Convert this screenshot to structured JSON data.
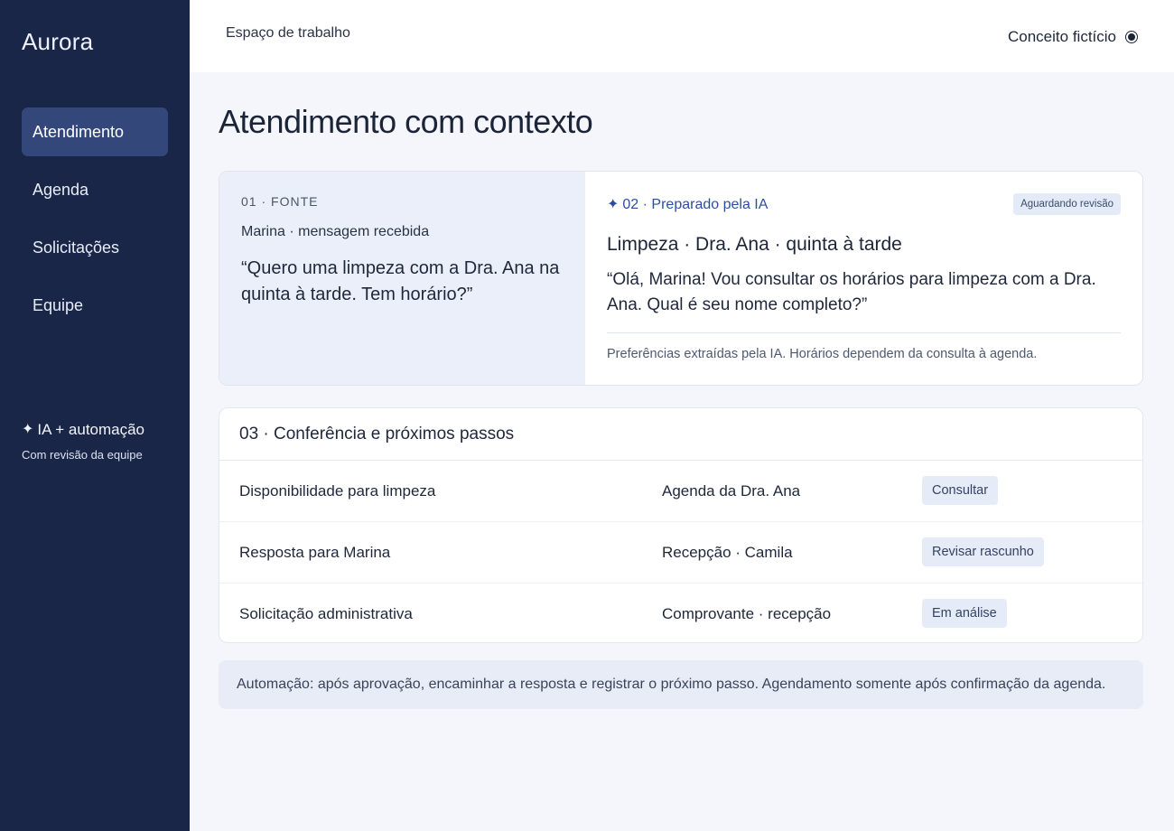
{
  "app": {
    "name": "Aurora"
  },
  "sidebar": {
    "items": [
      {
        "label": "Atendimento",
        "active": true
      },
      {
        "label": "Agenda",
        "active": false
      },
      {
        "label": "Solicitações",
        "active": false
      },
      {
        "label": "Equipe",
        "active": false
      }
    ],
    "ai_title": "IA + automação",
    "ai_subtitle": "Com revisão da equipe",
    "ai_icon": "sparkle-icon"
  },
  "topbar": {
    "workspace": "Espaço de trabalho",
    "concept_label": "Conceito fictício",
    "concept_icon": "radio-icon"
  },
  "main": {
    "title": "Atendimento com contexto",
    "source": {
      "label": "01 · FONTE",
      "from": "Marina · mensagem recebida",
      "message": "“Quero uma limpeza com a Dra. Ana na quinta à tarde. Tem horário?”"
    },
    "prepared": {
      "label": "02 · Preparado pela IA",
      "status_badge": "Aguardando revisão",
      "title": "Limpeza · Dra. Ana · quinta à tarde",
      "reply": "“Olá, Marina! Vou consultar os horários para limpeza com a Dra. Ana. Qual é seu nome completo?”",
      "note": "Preferências extraídas pela IA. Horários dependem da consulta à agenda."
    },
    "steps": {
      "title": "03 · Conferência e próximos passos",
      "rows": [
        {
          "task": "Disponibilidade para limpeza",
          "owner": "Agenda da Dra. Ana",
          "action": "Consultar"
        },
        {
          "task": "Resposta para Marina",
          "owner": "Recepção · Camila",
          "action": "Revisar rascunho"
        },
        {
          "task": "Solicitação administrativa",
          "owner": "Comprovante · recepção",
          "action": "Em análise"
        }
      ]
    },
    "automation_note": "Automação: após aprovação, encaminhar a resposta e registrar o próximo passo. Agendamento somente após confirmação da agenda."
  },
  "colors": {
    "sidebar_bg": "#192647",
    "active_nav": "#33477a",
    "accent": "#2d4e9e",
    "page_bg": "#f4f6fb"
  }
}
